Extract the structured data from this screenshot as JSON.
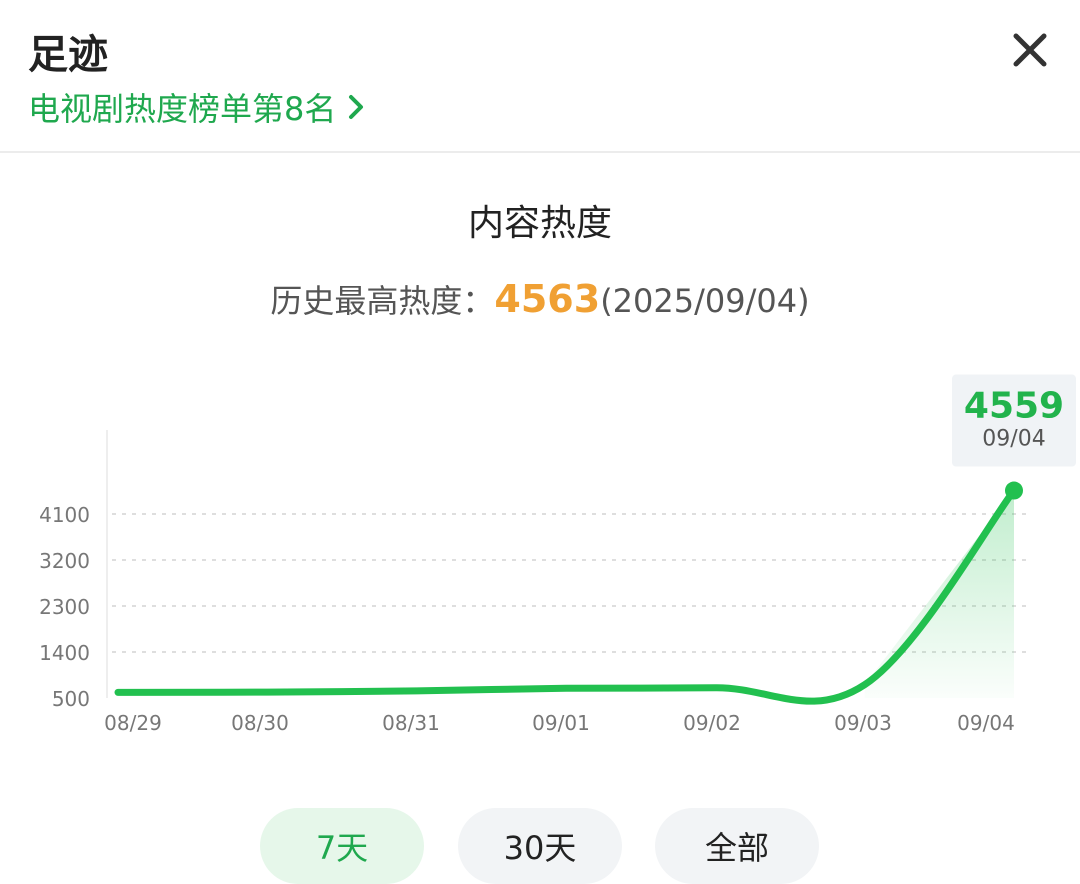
{
  "header": {
    "title": "足迹",
    "rank_link": "电视剧热度榜单第8名"
  },
  "section": {
    "title": "内容热度",
    "history_label": "历史最高热度：",
    "history_peak": "4563",
    "history_date": "(2025/09/04)"
  },
  "tooltip": {
    "value": "4559",
    "date": "09/04"
  },
  "tabs": [
    {
      "label": "7天",
      "active": true
    },
    {
      "label": "30天",
      "active": false
    },
    {
      "label": "全部",
      "active": false
    }
  ],
  "colors": {
    "accent": "#1fa84e",
    "line": "#22c04f",
    "peak": "#f0a033"
  },
  "chart_data": {
    "type": "area",
    "x": [
      "08/29",
      "08/30",
      "08/31",
      "09/01",
      "09/02",
      "09/03",
      "09/04"
    ],
    "values": [
      610,
      615,
      640,
      690,
      700,
      760,
      4559
    ],
    "yticks": [
      "500",
      "1400",
      "2300",
      "3200",
      "4100"
    ],
    "ylim": [
      500,
      4560
    ],
    "grid": true,
    "highlight": {
      "label": "09/04",
      "value": 4559
    }
  }
}
